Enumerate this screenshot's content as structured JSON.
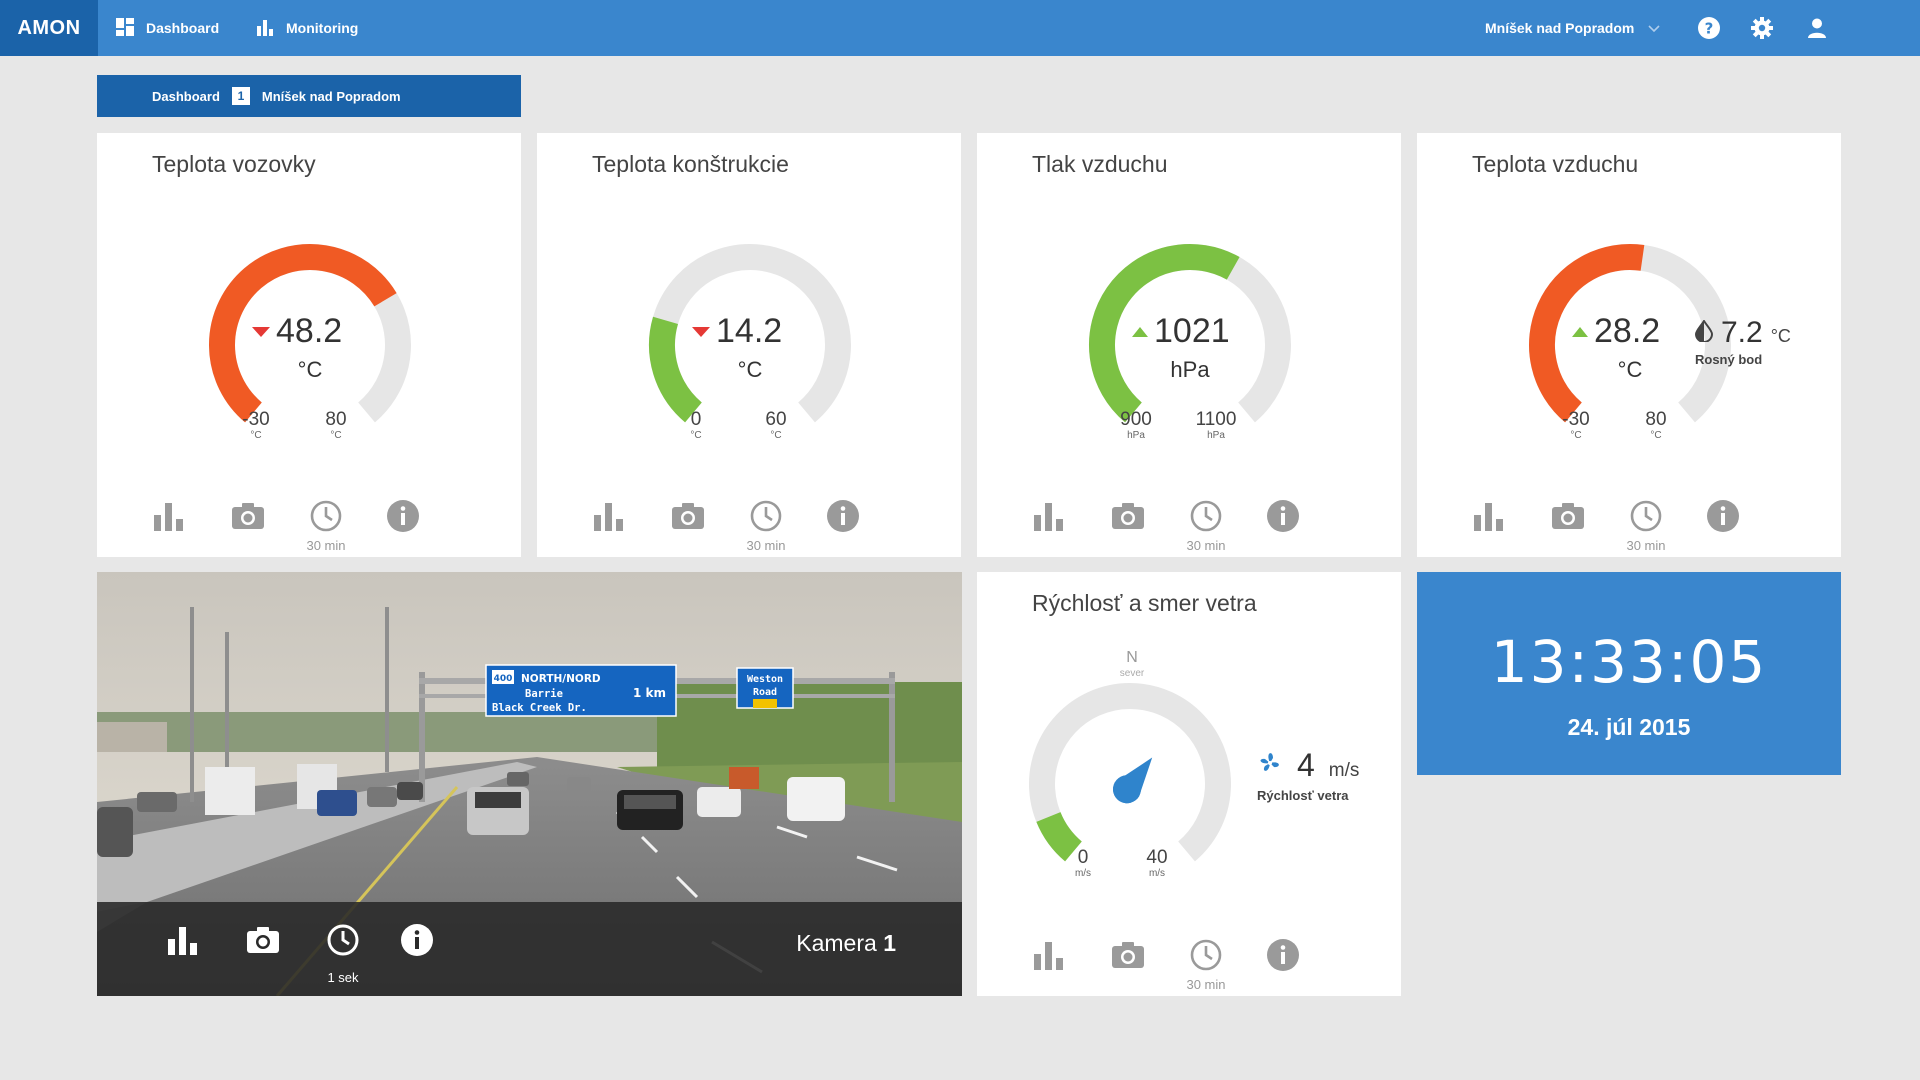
{
  "app": {
    "brand": "AMON"
  },
  "nav": {
    "dashboard": "Dashboard",
    "monitoring": "Monitoring"
  },
  "location_select": {
    "selected": "Mníšek nad Popradom"
  },
  "breadcrumb": {
    "root": "Dashboard",
    "number": "1",
    "location": "Mníšek nad Popradom"
  },
  "colors": {
    "accent": "#3a86cd",
    "dark_accent": "#1b63a9",
    "hot": "#f05a24",
    "cold": "#7cc143",
    "track": "#e6e6e6",
    "needle": "#2f84cc"
  },
  "cards": [
    {
      "title": "Teplota vozovky",
      "value": "48.2",
      "trend": "down",
      "unit": "°C",
      "min": "-30",
      "max": "80",
      "min_unit": "°C",
      "max_unit": "°C",
      "value_num": 48.2,
      "min_num": -30,
      "max_num": 80,
      "color": "#f05a24",
      "tool_label": "30 min"
    },
    {
      "title": "Teplota konštrukcie",
      "value": "14.2",
      "trend": "down",
      "unit": "°C",
      "min": "0",
      "max": "60",
      "min_unit": "°C",
      "max_unit": "°C",
      "value_num": 14.2,
      "min_num": 0,
      "max_num": 60,
      "color": "#7cc143",
      "tool_label": "30 min"
    },
    {
      "title": "Tlak vzduchu",
      "value": "1021",
      "trend": "up",
      "unit": "hPa",
      "min": "900",
      "max": "1100",
      "min_unit": "hPa",
      "max_unit": "hPa",
      "value_num": 1021,
      "min_num": 900,
      "max_num": 1100,
      "color": "#7cc143",
      "tool_label": "30 min"
    },
    {
      "title": "Teplota vzduchu",
      "value": "28.2",
      "trend": "up",
      "unit": "°C",
      "min": "-30",
      "max": "80",
      "min_unit": "°C",
      "max_unit": "°C",
      "value_num": 28.2,
      "min_num": -30,
      "max_num": 80,
      "color": "#f05a24",
      "tool_label": "30 min",
      "dew_point": {
        "value": "7.2",
        "unit": "°C",
        "label": "Rosný bod"
      }
    }
  ],
  "camera": {
    "name_prefix": "Kamera",
    "name_number": "1",
    "tool_label": "1 sek",
    "sign_main": {
      "route": "400",
      "line1": "NORTH/NORD",
      "line2": "Barrie",
      "line3": "Black Creek Dr.",
      "distance": "1 km"
    },
    "sign_side": {
      "line1": "Weston",
      "line2": "Road"
    }
  },
  "wind": {
    "title": "Rýchlosť a smer vetra",
    "direction": "N",
    "direction_label": "sever",
    "speed": "4",
    "speed_num": 4,
    "speed_unit": "m/s",
    "speed_label": "Rýchlosť vetra",
    "min": "0",
    "max": "40",
    "min_unit": "m/s",
    "max_unit": "m/s",
    "min_num": 0,
    "max_num": 40,
    "direction_deg": 30,
    "tool_label": "30 min"
  },
  "clock": {
    "time": "13:33:05",
    "date": "24. júl 2015"
  }
}
